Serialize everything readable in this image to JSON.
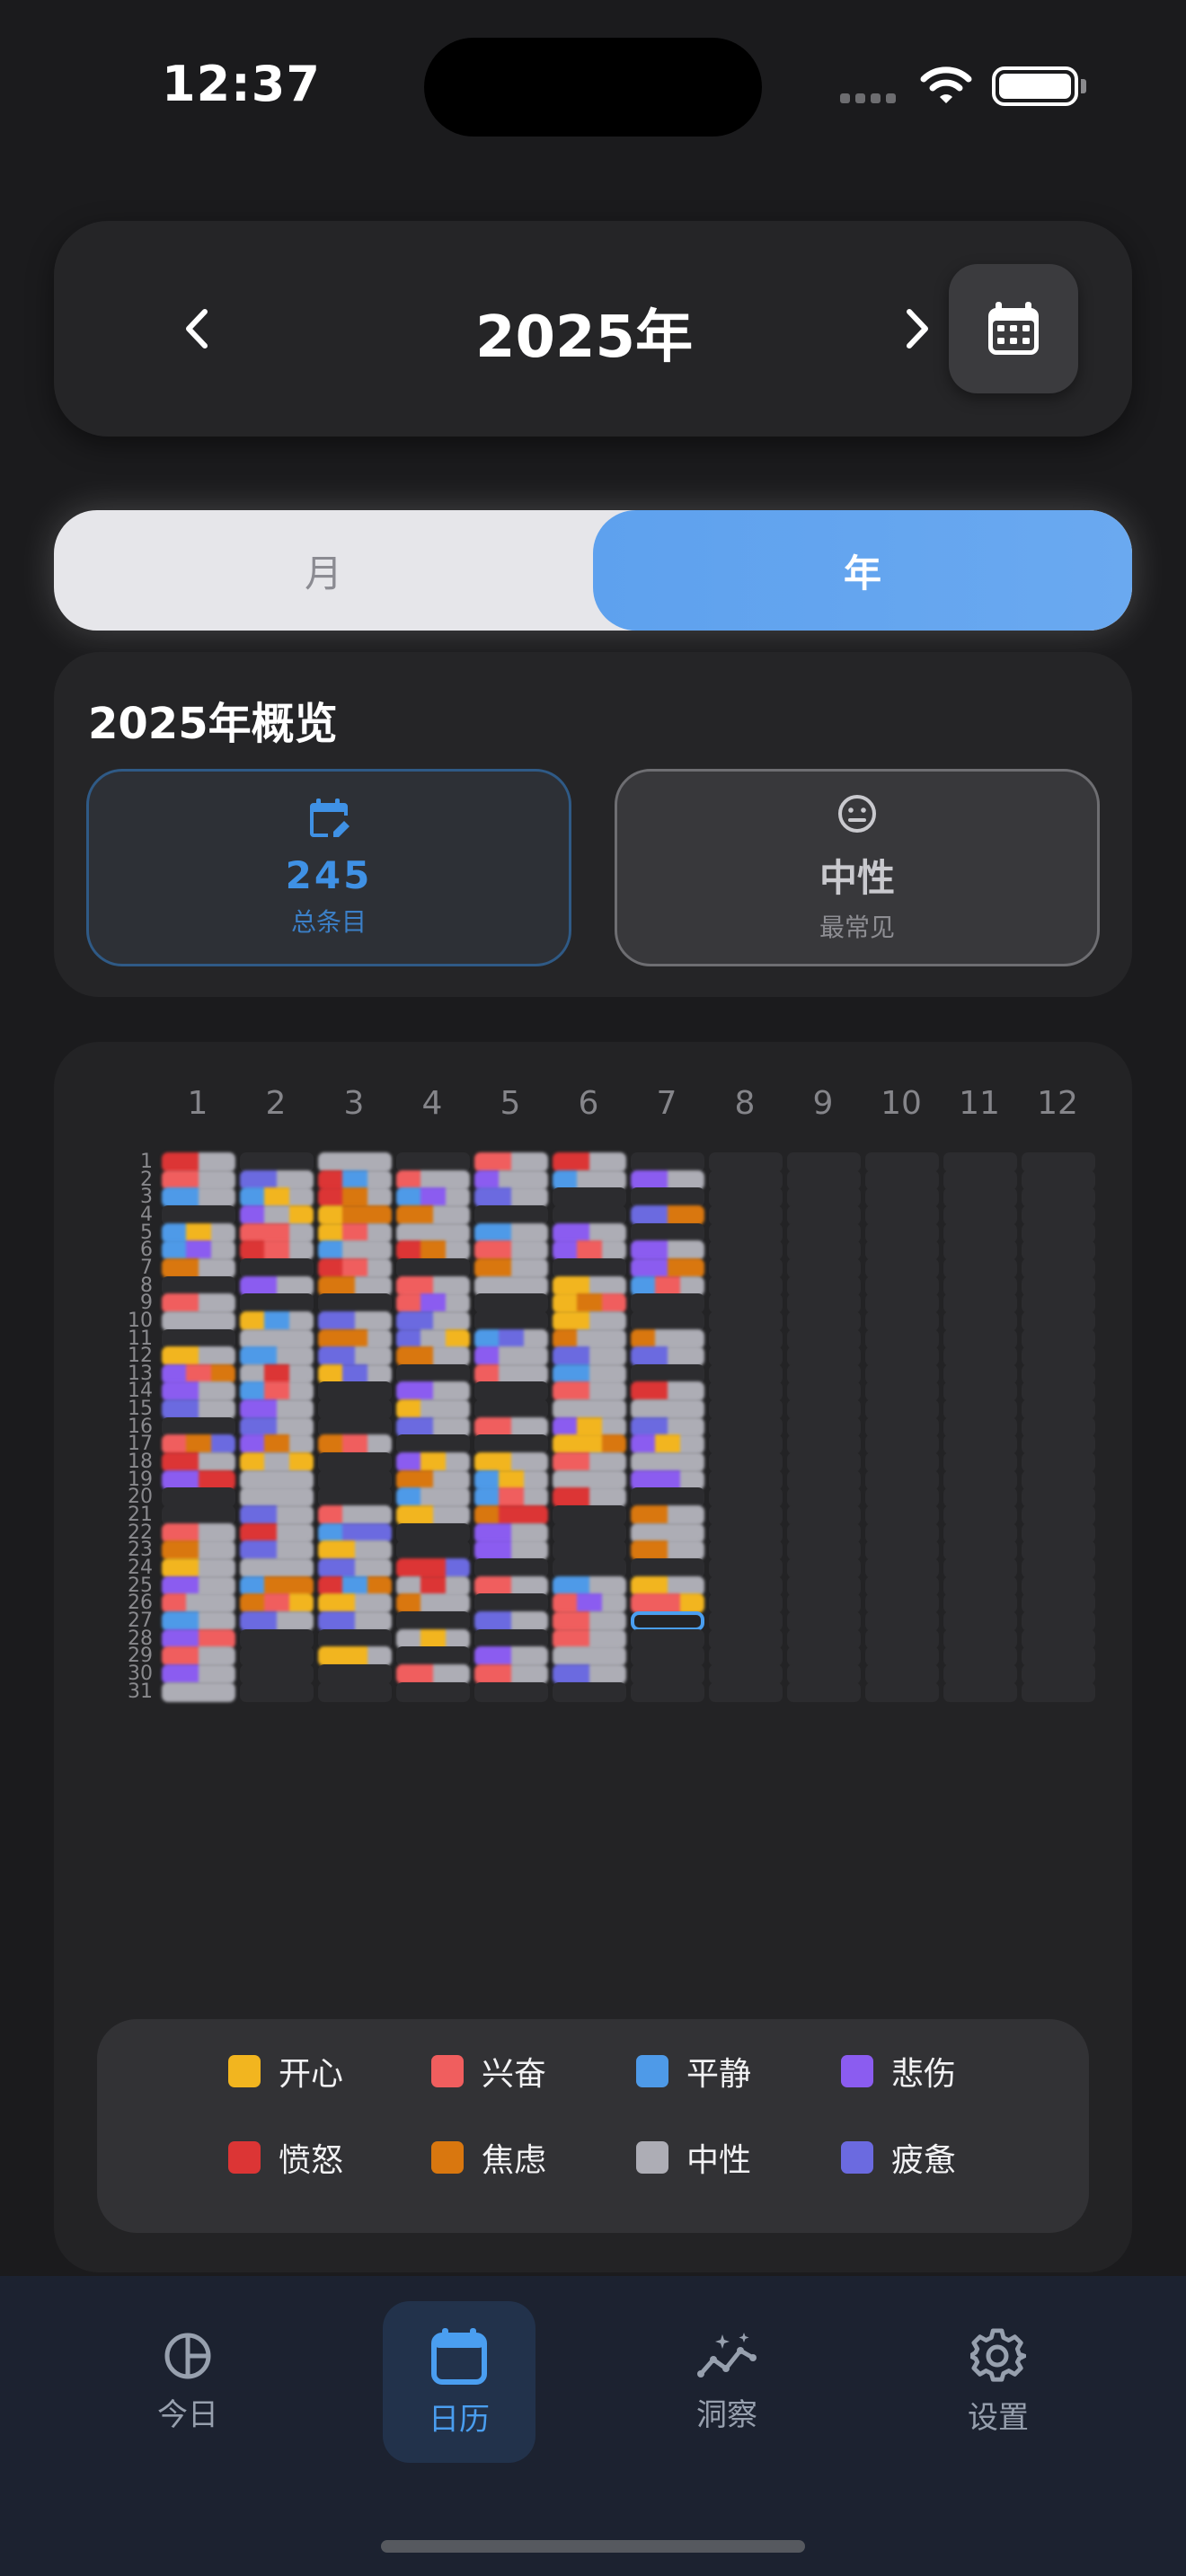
{
  "status_bar": {
    "time": "12:37"
  },
  "header": {
    "year_title": "2025年"
  },
  "view_toggle": {
    "month_label": "月",
    "year_label": "年",
    "selected": "年"
  },
  "overview": {
    "title": "2025年概览",
    "entries": {
      "value": "245",
      "label": "总条目"
    },
    "top_mood": {
      "value": "中性",
      "label": "最常见"
    }
  },
  "heatmap": {
    "months": [
      "1",
      "2",
      "3",
      "4",
      "5",
      "6",
      "7",
      "8",
      "9",
      "10",
      "11",
      "12"
    ],
    "days": [
      "1",
      "2",
      "3",
      "4",
      "5",
      "6",
      "7",
      "8",
      "9",
      "10",
      "11",
      "12",
      "13",
      "14",
      "15",
      "16",
      "17",
      "18",
      "19",
      "20",
      "21",
      "22",
      "23",
      "24",
      "25",
      "26",
      "27",
      "28",
      "29",
      "30",
      "31"
    ],
    "today": {
      "month": 7,
      "day": 27
    },
    "mood_colors": {
      "H": "#f2b51f",
      "E": "#f05e5e",
      "C": "#4e9ae8",
      "S": "#8b5cf0",
      "A": "#dc3535",
      "X": "#d9770f",
      "N": "#adadb5",
      "T": "#6b6ae0"
    },
    "entries": {
      "1": [
        "AN",
        "EN",
        "CN",
        "",
        "CHN",
        "CSN",
        "XN",
        "",
        "EN",
        "NN",
        "",
        "HN",
        "SEX",
        "SN",
        "TN",
        "",
        "EXT",
        "AN",
        "SA",
        "",
        "",
        "EN",
        "XN",
        "HN",
        "SN",
        "ENN",
        "CN",
        "SE",
        "EN",
        "SN",
        "NN"
      ],
      "2": [
        "",
        "TN",
        "CHN",
        "SNH",
        "EEN",
        "AEN",
        "",
        "SN",
        "",
        "HCN",
        "NN",
        "CN",
        "NAN",
        "CEN",
        "SN",
        "TN",
        "SXN",
        "HNH",
        "NN",
        "NN",
        "TN",
        "AN",
        "TN",
        "NN",
        "CXX",
        "XEH",
        "TN",
        "",
        "",
        "",
        ""
      ],
      "3": [
        "NN",
        "ACN",
        "AXN",
        "HXX",
        "HEN",
        "CNN",
        "AEN",
        "XN",
        "",
        "TN",
        "XXN",
        "TN",
        "HTN",
        "",
        "",
        "",
        "XEN",
        "",
        "",
        "",
        "ENN",
        "CTT",
        "HN",
        "TN",
        "ACX",
        "HN",
        "TN",
        "",
        "HHN",
        "",
        ""
      ],
      "4": [
        "",
        "ENN",
        "CSN",
        "XN",
        "NN",
        "AXN",
        "",
        "EN",
        "ESN",
        "TN",
        "TNH",
        "XN",
        "",
        "SN",
        "HNN",
        "TN",
        "",
        "SHN",
        "XN",
        "CNN",
        "HN",
        "",
        "",
        "AAT",
        "NAN",
        "XNN",
        "",
        "NHN",
        "",
        "EN",
        ""
      ],
      "5": [
        "EN",
        "SNN",
        "TN",
        "",
        "CN",
        "EN",
        "XN",
        "NN",
        "",
        "",
        "CTN",
        "SNN",
        "ENN",
        "",
        "",
        "EN",
        "",
        "HN",
        "CHN",
        "CEN",
        "XAA",
        "SN",
        "SN",
        "",
        "EN",
        "",
        "TN",
        "",
        "SN",
        "EN",
        ""
      ],
      "6": [
        "AN",
        "CNN",
        "",
        "",
        "SN",
        "SEN",
        "",
        "HN",
        "HXE",
        "HN",
        "XNN",
        "TN",
        "CN",
        "EN",
        "NN",
        "SHN",
        "HHX",
        "EN",
        "NNN",
        "AN",
        "",
        "",
        "",
        "",
        "CN",
        "ESN",
        "EN",
        "EN",
        "NN",
        "TN",
        ""
      ],
      "7": [
        "",
        "SN",
        "",
        "TX",
        "",
        "SN",
        "SX",
        "CEN",
        "",
        "",
        "XNN",
        "TN",
        "",
        "AN",
        "NN",
        "TN",
        "SHN",
        "NN",
        "SSN",
        "",
        "XN",
        "NN",
        "XN",
        "",
        "HN",
        "EEH",
        "",
        "",
        "",
        "",
        ""
      ]
    }
  },
  "legend": [
    {
      "key": "H",
      "label": "开心",
      "color": "#f2b51f"
    },
    {
      "key": "E",
      "label": "兴奋",
      "color": "#f05e5e"
    },
    {
      "key": "C",
      "label": "平静",
      "color": "#4e9ae8"
    },
    {
      "key": "S",
      "label": "悲伤",
      "color": "#8b5cf0"
    },
    {
      "key": "A",
      "label": "愤怒",
      "color": "#dc3535"
    },
    {
      "key": "X",
      "label": "焦虑",
      "color": "#d9770f"
    },
    {
      "key": "N",
      "label": "中性",
      "color": "#adadb5"
    },
    {
      "key": "T",
      "label": "疲惫",
      "color": "#6b6ae0"
    }
  ],
  "tab_bar": {
    "tabs": [
      {
        "label": "今日",
        "icon": "pie-chart-icon"
      },
      {
        "label": "日历",
        "icon": "calendar-icon"
      },
      {
        "label": "洞察",
        "icon": "sparkle-chart-icon"
      },
      {
        "label": "设置",
        "icon": "gear-icon"
      }
    ],
    "active": "日历"
  }
}
